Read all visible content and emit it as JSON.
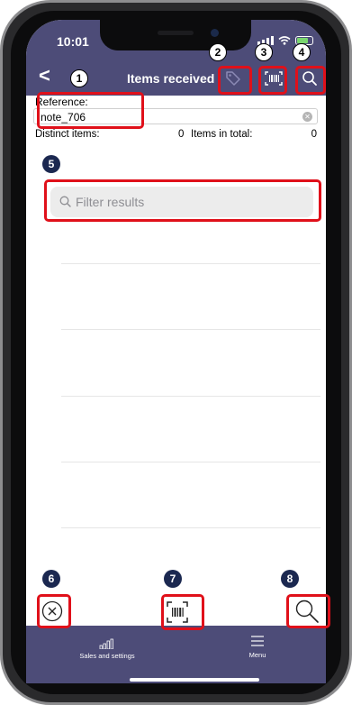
{
  "status_bar": {
    "time": "10:01"
  },
  "nav": {
    "title": "Items received",
    "back_glyph": "<"
  },
  "reference": {
    "label": "Reference:",
    "value": "note_706"
  },
  "stats": {
    "distinct_label": "Distinct items:",
    "distinct_value": "0",
    "total_label": "Items in total:",
    "total_value": "0"
  },
  "filter": {
    "placeholder": "Filter results"
  },
  "tabbar": {
    "items": [
      {
        "label": "Sales and settings",
        "icon": "bar-chart-icon"
      },
      {
        "label": "Menu",
        "icon": "menu-icon"
      }
    ]
  },
  "annotations": [
    "1",
    "2",
    "3",
    "4",
    "5",
    "6",
    "7",
    "8"
  ],
  "colors": {
    "header": "#4d4c78",
    "highlight": "#e0101a",
    "badge_dark": "#1b2850"
  }
}
